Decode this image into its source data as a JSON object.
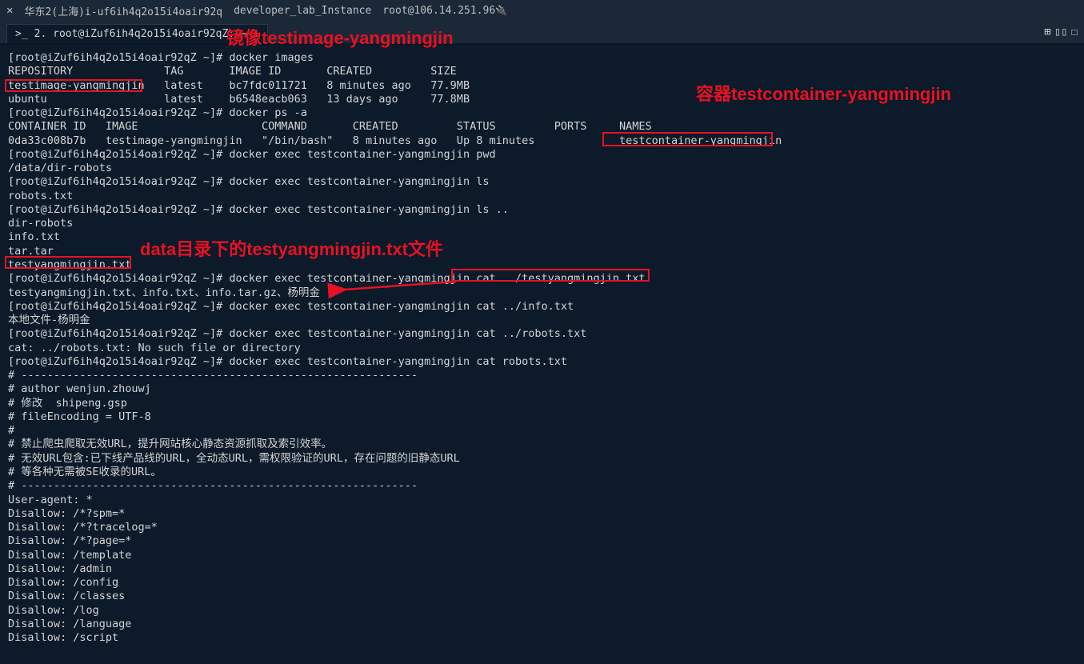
{
  "topbar": {
    "close_icon": "✕",
    "region": "华东2(上海)i-uf6ih4q2o15i4oair92q",
    "instance": "developer_lab_Instance",
    "root": "root@106.14.251.96",
    "rootglyph": "🔌"
  },
  "tab": {
    "prefix": ">_",
    "label": "2. root@iZuf6ih4q2o15i4oair92qZ: ~",
    "close": "✕"
  },
  "tabright": {
    "plus": "⊞",
    "split1": "▯▯",
    "split2": "☐"
  },
  "annotations": {
    "image_label": "镜像testimage-yangmingjin",
    "container_label": "容器testcontainer-yangmingjin",
    "file_label": "data目录下的testyangmingjin.txt文件"
  },
  "term": {
    "l1": "[root@iZuf6ih4q2o15i4oair92qZ ~]# docker images",
    "l2": "REPOSITORY              TAG       IMAGE ID       CREATED         SIZE",
    "l3": "testimage-yangmingjin   latest    bc7fdc011721   8 minutes ago   77.9MB",
    "l4": "ubuntu                  latest    b6548eacb063   13 days ago     77.8MB",
    "l5": "[root@iZuf6ih4q2o15i4oair92qZ ~]# docker ps -a",
    "l6": "CONTAINER ID   IMAGE                   COMMAND       CREATED         STATUS         PORTS     NAMES",
    "l7": "0da33c008b7b   testimage-yangmingjin   \"/bin/bash\"   8 minutes ago   Up 8 minutes             testcontainer-yangmingjin",
    "l8": "[root@iZuf6ih4q2o15i4oair92qZ ~]# docker exec testcontainer-yangmingjin pwd",
    "l9": "/data/dir-robots",
    "l10": "[root@iZuf6ih4q2o15i4oair92qZ ~]# docker exec testcontainer-yangmingjin ls",
    "l11": "robots.txt",
    "l12": "[root@iZuf6ih4q2o15i4oair92qZ ~]# docker exec testcontainer-yangmingjin ls ..",
    "l13": "dir-robots",
    "l14": "info.txt",
    "l15": "tar.tar",
    "l16": "testyangmingjin.txt",
    "l17": "[root@iZuf6ih4q2o15i4oair92qZ ~]# docker exec testcontainer-yangmingjin cat ../testyangmingjin.txt",
    "l18": "testyangmingjin.txt、info.txt、info.tar.gz、杨明金",
    "l19": "[root@iZuf6ih4q2o15i4oair92qZ ~]# docker exec testcontainer-yangmingjin cat ../info.txt",
    "l20": "本地文件-杨明金",
    "l21": "[root@iZuf6ih4q2o15i4oair92qZ ~]# docker exec testcontainer-yangmingjin cat ../robots.txt",
    "l22": "cat: ../robots.txt: No such file or directory",
    "l23": "[root@iZuf6ih4q2o15i4oair92qZ ~]# docker exec testcontainer-yangmingjin cat robots.txt",
    "l24": "# -------------------------------------------------------------",
    "l25": "# author wenjun.zhouwj",
    "l26": "# 修改  shipeng.gsp",
    "l27": "# fileEncoding = UTF-8",
    "l28": "#",
    "l29": "# 禁止爬虫爬取无效URL，提升网站核心静态资源抓取及索引效率。",
    "l30": "# 无效URL包含:已下线产品线的URL，全动态URL，需权限验证的URL，存在问题的旧静态URL",
    "l31": "# 等各种无需被SE收录的URL。",
    "l32": "# -------------------------------------------------------------",
    "l33": "User-agent: *",
    "l34": "Disallow: /*?spm=*",
    "l35": "Disallow: /*?tracelog=*",
    "l36": "Disallow: /*?page=*",
    "l37": "Disallow: /template",
    "l38": "Disallow: /admin",
    "l39": "Disallow: /config",
    "l40": "Disallow: /classes",
    "l41": "Disallow: /log",
    "l42": "Disallow: /language",
    "l43": "Disallow: /script"
  }
}
